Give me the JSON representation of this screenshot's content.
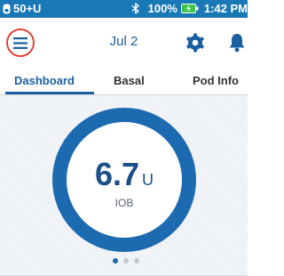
{
  "status_bar": {
    "pod_status": "50+U",
    "bluetooth_icon": "bluetooth-icon",
    "battery_percent": "100%",
    "battery_icon": "battery-charging-icon",
    "time": "1:42 PM",
    "background_color": "#1978b6"
  },
  "header": {
    "menu_icon": "hamburger-menu-icon",
    "date": "Jul 2",
    "settings_icon": "gear-icon",
    "notifications_icon": "bell-icon",
    "menu_highlight_color": "#e0443a"
  },
  "tabs": [
    {
      "label": "Dashboard",
      "active": true
    },
    {
      "label": "Basal",
      "active": false
    },
    {
      "label": "Pod Info",
      "active": false
    }
  ],
  "dashboard": {
    "iob_value": "6.7",
    "iob_unit": "U",
    "iob_label": "IOB",
    "ring_color": "#1c6ab0",
    "page_count": 3,
    "active_page": 1
  }
}
